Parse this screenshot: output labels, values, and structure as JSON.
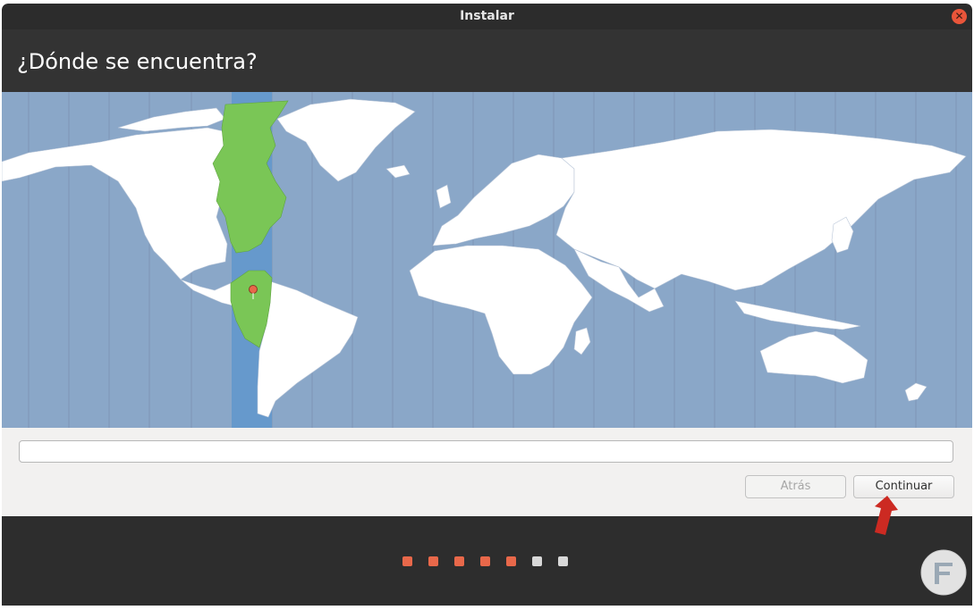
{
  "window": {
    "title": "Instalar"
  },
  "header": {
    "title": "¿Dónde se encuentra?"
  },
  "location_input": {
    "value": "",
    "placeholder": ""
  },
  "buttons": {
    "back_label": "Atrás",
    "continue_label": "Continuar"
  },
  "progress": {
    "total_steps": 7,
    "completed_steps": 5,
    "dots": [
      {
        "state": "done",
        "color": "#e8684a"
      },
      {
        "state": "done",
        "color": "#e8684a"
      },
      {
        "state": "done",
        "color": "#e8684a"
      },
      {
        "state": "done",
        "color": "#e8684a"
      },
      {
        "state": "done",
        "color": "#e8684a"
      },
      {
        "state": "pending",
        "color": "#d8d8d8"
      },
      {
        "state": "pending",
        "color": "#d8d8d8"
      }
    ]
  },
  "map": {
    "selected_timezone_color": "#6699cc",
    "selected_region_color": "#7ac656",
    "ocean_color": "#8aa7c8",
    "land_color": "#ffffff",
    "pin_color": "#e8684a"
  },
  "colors": {
    "accent": "#e8684a",
    "close": "#e9553a",
    "annotation_arrow": "#cc2a22"
  }
}
